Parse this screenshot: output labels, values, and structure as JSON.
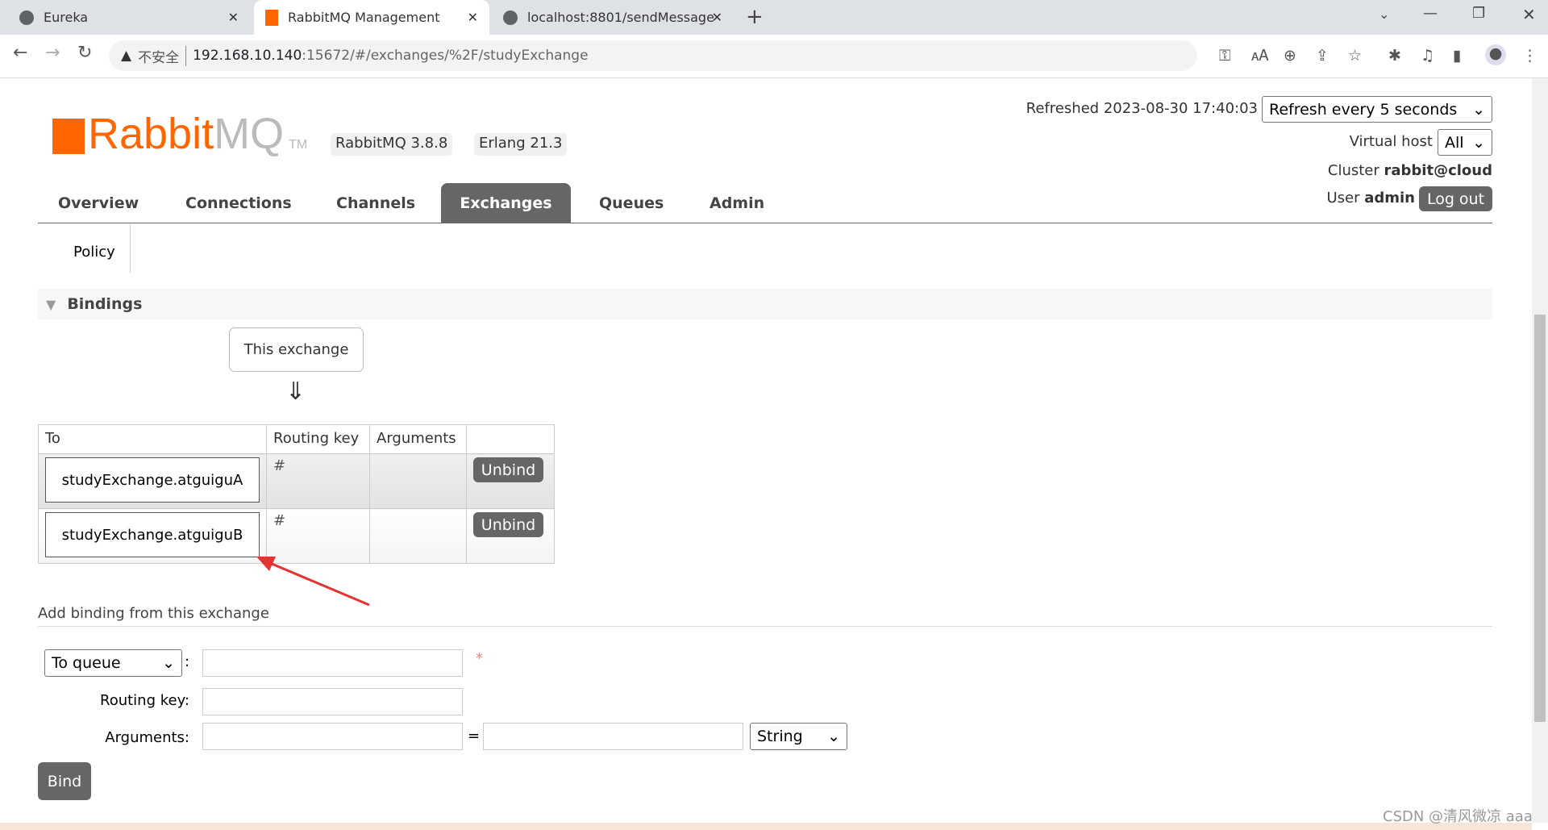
{
  "browser": {
    "tabs": [
      {
        "label": "Eureka",
        "icon": "globe-icon"
      },
      {
        "label": "RabbitMQ Management",
        "icon": "rabbitmq-icon",
        "active": true
      },
      {
        "label": "localhost:8801/sendMessage",
        "icon": "globe-icon"
      }
    ],
    "security_label": "不安全",
    "url_host": "192.168.10.140",
    "url_rest": ":15672/#/exchanges/%2F/studyExchange"
  },
  "header": {
    "logo_rabbit": "Rabbit",
    "logo_mq": "MQ",
    "logo_tm": "TM",
    "version": "RabbitMQ 3.8.8",
    "erlang": "Erlang 21.3",
    "refreshed": "Refreshed 2023-08-30 17:40:03",
    "refresh_select": "Refresh every 5 seconds",
    "vhost_label": "Virtual host",
    "vhost_value": "All",
    "cluster_label": "Cluster",
    "cluster_value": "rabbit@cloud",
    "user_label": "User",
    "user_value": "admin",
    "logout": "Log out"
  },
  "nav": [
    "Overview",
    "Connections",
    "Channels",
    "Exchanges",
    "Queues",
    "Admin"
  ],
  "nav_active": "Exchanges",
  "policy_label": "Policy",
  "bindings": {
    "title": "Bindings",
    "this_exchange": "This exchange",
    "arrow": "⇓",
    "columns": [
      "To",
      "Routing key",
      "Arguments",
      ""
    ],
    "rows": [
      {
        "to": "studyExchange.atguiguA",
        "routing_key": "#",
        "arguments": "",
        "action": "Unbind"
      },
      {
        "to": "studyExchange.atguiguB",
        "routing_key": "#",
        "arguments": "",
        "action": "Unbind"
      }
    ]
  },
  "add_binding": {
    "title": "Add binding from this exchange",
    "dest_select": "To queue",
    "colon": ":",
    "required": "*",
    "routing_label": "Routing key:",
    "args_label": "Arguments:",
    "equals": "=",
    "type_select": "String",
    "bind": "Bind"
  },
  "watermark": "CSDN @清风微凉 aaa",
  "colors": {
    "brand": "#ff6600",
    "button": "#666666",
    "annotation_arrow": "#e53333"
  }
}
